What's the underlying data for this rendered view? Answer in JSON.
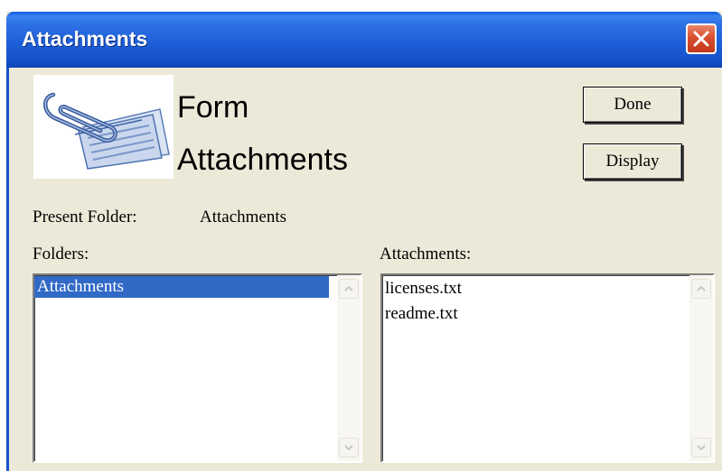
{
  "window": {
    "title": "Attachments"
  },
  "header": {
    "title_line1": "Form",
    "title_line2": "Attachments"
  },
  "buttons": {
    "done": "Done",
    "display": "Display"
  },
  "present_folder": {
    "label": "Present Folder:",
    "value": "Attachments"
  },
  "folders": {
    "label": "Folders:",
    "items": [
      "Attachments"
    ],
    "selected": "Attachments"
  },
  "attachments": {
    "label": "Attachments:",
    "items": [
      "licenses.txt",
      "readme.txt"
    ]
  },
  "colors": {
    "titlebar": "#1d5fd8",
    "selection": "#3169c6",
    "dialog_bg": "#ece9d8",
    "close_button": "#d9502f"
  },
  "icons": {
    "logo": "paperclip-document-icon",
    "close": "close-icon",
    "scroll_up": "scroll-up-icon",
    "scroll_down": "scroll-down-icon"
  }
}
